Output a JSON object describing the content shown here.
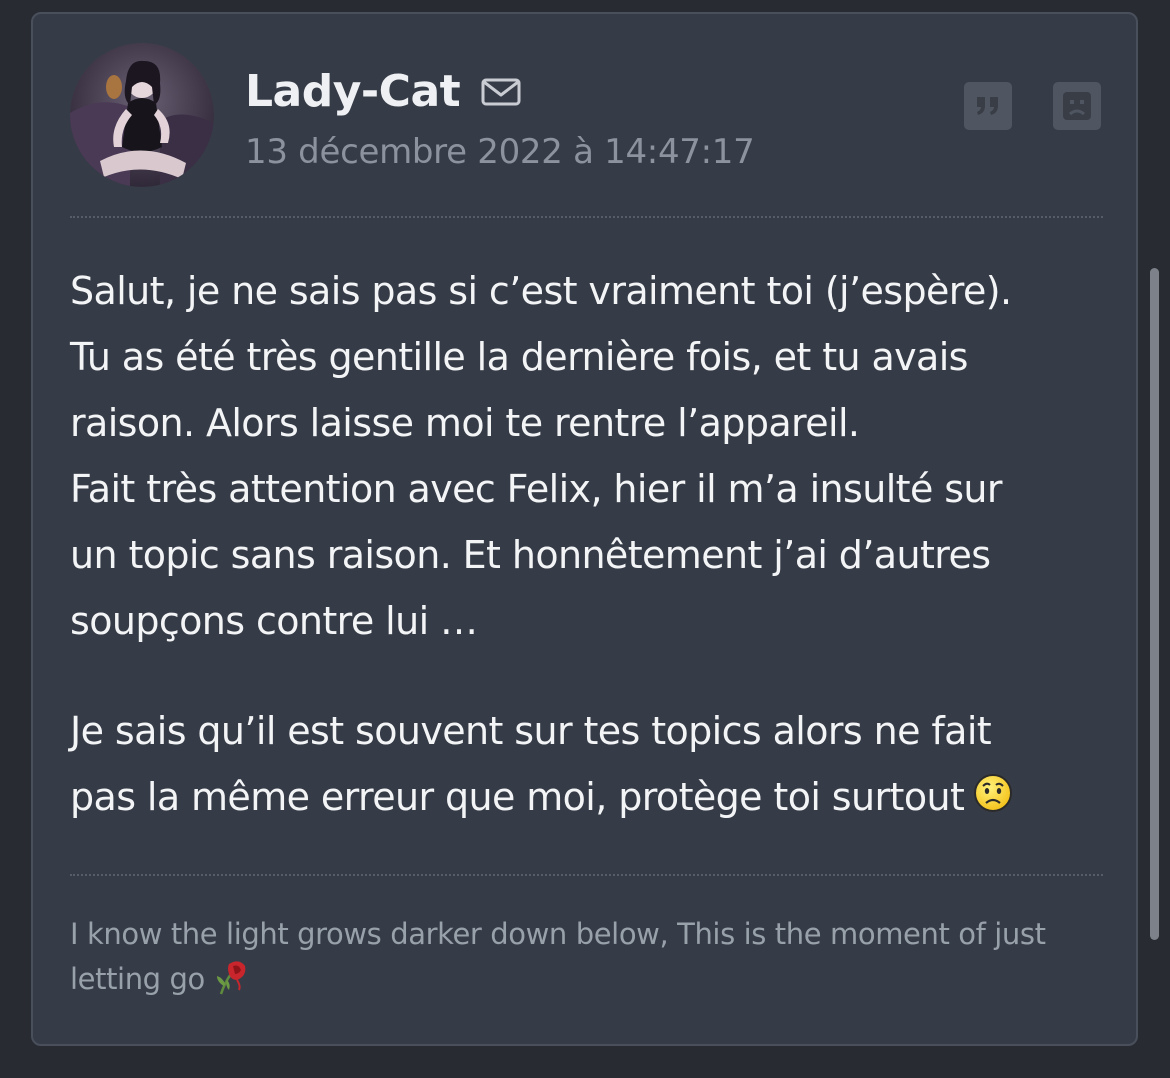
{
  "post": {
    "author": {
      "username": "Lady-Cat",
      "avatar": "avatar"
    },
    "date": "13 décembre 2022 à 14:47:17",
    "icons": {
      "mail": "mail-icon",
      "quote": "quote-icon",
      "report": "sad-face-icon"
    },
    "message": {
      "paragraph1": [
        "Salut, je ne sais pas si c’est vraiment toi (j’espère).",
        "Tu as été très gentille la dernière fois, et tu avais",
        "raison. Alors laisse moi te rentre l’appareil.",
        "Fait très attention avec Felix, hier il m’a insulté sur",
        "un topic sans raison. Et honnêtement j’ai d’autres",
        "soupçons contre lui …"
      ],
      "paragraph2": [
        "Je sais qu’il est souvent sur tes topics alors ne fait",
        "pas la même erreur que moi, protège toi surtout"
      ],
      "emoji": "worried-face-emoji"
    },
    "signature": {
      "lines": [
        "I know the light grows darker down below, This is the moment of just",
        "letting go"
      ],
      "emoji": "wilted-rose-emoji"
    }
  },
  "colors": {
    "background": "#282c32",
    "card": "#363c47",
    "card_border": "#49505c",
    "text": "#f3f4f6",
    "muted": "#8c939e",
    "button": "#505661"
  }
}
